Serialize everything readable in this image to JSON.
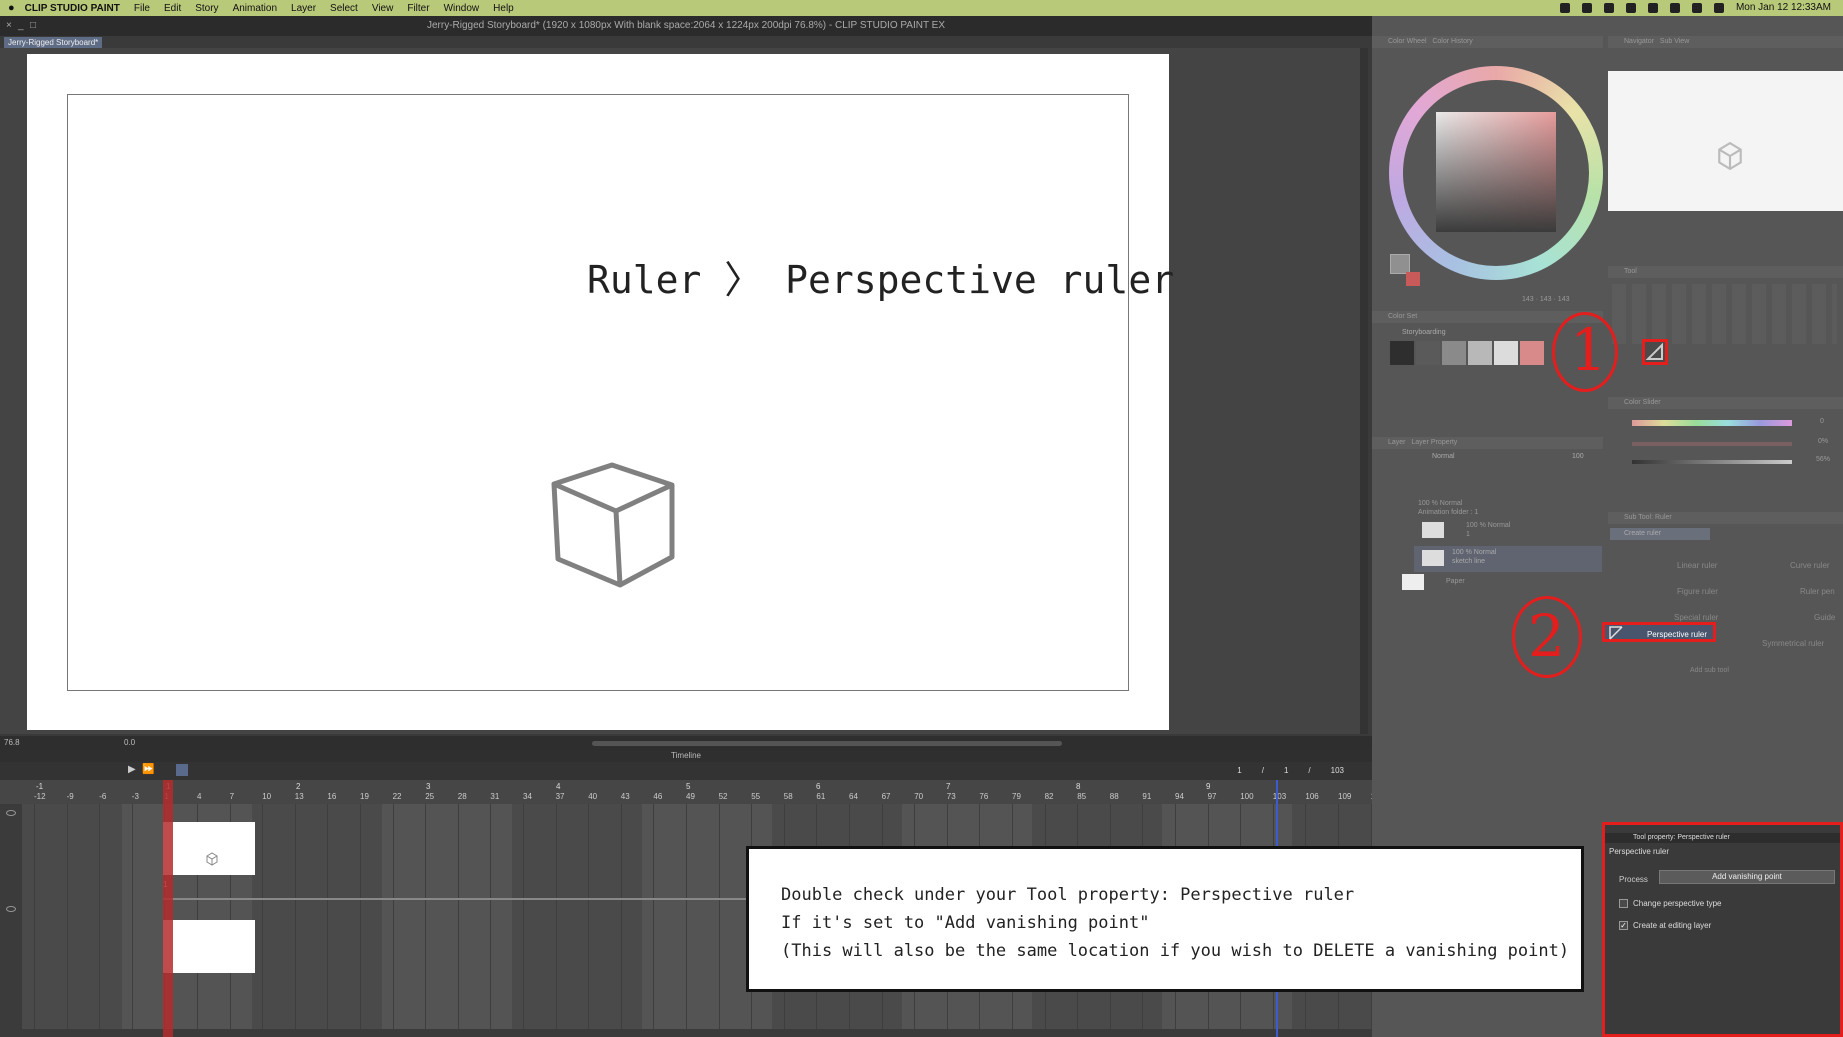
{
  "menubar": {
    "app_name": "CLIP STUDIO PAINT",
    "items": [
      "File",
      "Edit",
      "Story",
      "Animation",
      "Layer",
      "Select",
      "View",
      "Filter",
      "Window",
      "Help"
    ],
    "datetime": "Mon Jan 12  12:33AM",
    "bg_color": "#b9c97a"
  },
  "window": {
    "title": "Jerry-Rigged Storyboard* (1920 x 1080px With blank space:2064 x 1224px 200dpi 76.8%)  - CLIP STUDIO PAINT EX",
    "doc_tab": "Jerry-Rigged Storyboard*"
  },
  "canvas": {
    "annotation": "Ruler 〉 Perspective ruler"
  },
  "statusbar": {
    "zoom": "76.8",
    "rotation": "0.0"
  },
  "timeline": {
    "title": "Timeline",
    "frame_counter": [
      "1",
      "/",
      "1",
      "/",
      "103"
    ],
    "sections": [
      "-1",
      "1",
      "2",
      "3",
      "4",
      "5",
      "6",
      "7",
      "8",
      "9"
    ],
    "ticks": [
      "-12",
      "-9",
      "-6",
      "-3",
      "1",
      "4",
      "7",
      "10",
      "13",
      "16",
      "19",
      "22",
      "25",
      "28",
      "31",
      "34",
      "37",
      "40",
      "43",
      "46",
      "49",
      "52",
      "55",
      "58",
      "61",
      "64",
      "67",
      "70",
      "73",
      "76",
      "79",
      "82",
      "85",
      "88",
      "91",
      "94",
      "97",
      "100",
      "103",
      "106",
      "109",
      "11"
    ],
    "track_marker": "1"
  },
  "panels": {
    "color_wheel": {
      "tab": "Color Wheel",
      "tab2": "Color History",
      "values": "143 · 143 · 143"
    },
    "navigator": {
      "tab": "Navigator",
      "tab2": "Sub View"
    },
    "tool": {
      "tab": "Tool"
    },
    "color_set": {
      "tab": "Color Set",
      "set_name": "Storyboarding"
    },
    "color_slider": {
      "tab": "Color Slider",
      "values": [
        "0",
        "0%",
        "56%"
      ]
    },
    "layer": {
      "tab": "Layer",
      "tab2": "Layer Property",
      "blend": "Normal",
      "opacity": "100",
      "layers": [
        {
          "line1": "100 % Normal",
          "line2": "Animation folder : 1"
        },
        {
          "line1": "100 % Normal",
          "line2": "1"
        },
        {
          "line1": "100 % Normal",
          "line2": "sketch line"
        },
        {
          "line1": "Paper",
          "line2": ""
        }
      ]
    },
    "sub_tool": {
      "tab": "Sub Tool: Ruler",
      "create_ruler": "Create ruler",
      "items": [
        "Linear ruler",
        "Curve ruler",
        "Figure ruler",
        "Ruler pen",
        "Special ruler",
        "Guide",
        "Perspective ruler",
        "Symmetrical ruler"
      ],
      "add_sub_tool": "Add sub tool"
    }
  },
  "tool_property": {
    "header": "Tool property: Perspective ruler",
    "name": "Perspective ruler",
    "process_label": "Process",
    "process_value": "Add vanishing point",
    "change_perspective_type": "Change perspective type",
    "create_at_editing_layer": "Create at editing layer",
    "change_checked": false,
    "create_checked": true
  },
  "callout": {
    "line1": "Double check under your Tool property: Perspective ruler",
    "line2": "If it's set to \"Add vanishing point\"",
    "line3": "(This will also be the same location if you wish to DELETE a vanishing point)"
  },
  "markers": {
    "one": "1",
    "two": "2",
    "color": "#e41d1d"
  }
}
